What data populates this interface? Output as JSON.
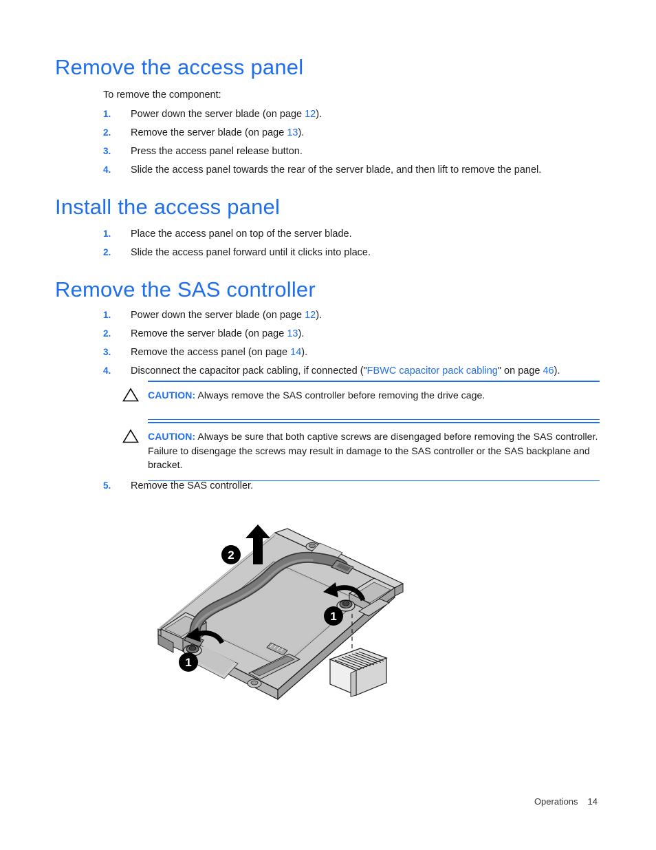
{
  "document": {
    "sections": [
      {
        "id": "remove-access-panel",
        "heading": "Remove the access panel",
        "intro": "To remove the component:",
        "steps": [
          {
            "num": "1.",
            "pre": "Power down the server blade (on page ",
            "link": "12",
            "post": ")."
          },
          {
            "num": "2.",
            "pre": "Remove the server blade (on page ",
            "link": "13",
            "post": ")."
          },
          {
            "num": "3.",
            "pre": "Press the access panel release button.",
            "link": "",
            "post": ""
          },
          {
            "num": "4.",
            "pre": "Slide the access panel towards the rear of the server blade, and then lift to remove the panel.",
            "link": "",
            "post": ""
          }
        ]
      },
      {
        "id": "install-access-panel",
        "heading": "Install the access panel",
        "steps": [
          {
            "num": "1.",
            "pre": "Place the access panel on top of the server blade.",
            "link": "",
            "post": ""
          },
          {
            "num": "2.",
            "pre": "Slide the access panel forward until it clicks into place.",
            "link": "",
            "post": ""
          }
        ]
      },
      {
        "id": "remove-sas-controller",
        "heading": "Remove the SAS controller",
        "steps": [
          {
            "num": "1.",
            "pre": "Power down the server blade (on page ",
            "link": "12",
            "post": ")."
          },
          {
            "num": "2.",
            "pre": "Remove the server blade (on page ",
            "link": "13",
            "post": ")."
          },
          {
            "num": "3.",
            "pre": "Remove the access panel (on page ",
            "link": "14",
            "post": ")."
          },
          {
            "num": "4.",
            "pre": "Disconnect the capacitor pack cabling, if connected (\"",
            "link": "FBWC capacitor pack cabling",
            "post": "\" on page ",
            "link2": "46",
            "post2": ")."
          }
        ],
        "final_step": {
          "num": "5.",
          "pre": "Remove the SAS controller.",
          "link": "",
          "post": ""
        }
      }
    ],
    "cautions": [
      {
        "icon": "warning-triangle-icon",
        "label": "CAUTION:",
        "text": "Always remove the SAS controller before removing the drive cage."
      },
      {
        "icon": "warning-triangle-icon",
        "label": "CAUTION:",
        "text": "Always be sure that both captive screws are disengaged before removing the SAS controller. Failure to disengage the screws may result in damage to the SAS controller or the SAS backplane and bracket."
      }
    ],
    "figure": {
      "name": "sas-controller-removal-diagram",
      "callouts": [
        {
          "id": "callout-1-left",
          "label": "1"
        },
        {
          "id": "callout-1-right",
          "label": "1"
        },
        {
          "id": "callout-2-lift",
          "label": "2"
        }
      ],
      "colors": {
        "board_fill": "#c9c9c9",
        "board_edge": "#1a1a1a",
        "cable": "#6f6f6f",
        "cable_dark": "#4b4b4b",
        "connector_fill": "#e8e8e8",
        "callout_bg": "#000000",
        "callout_text": "#ffffff"
      }
    },
    "footer": {
      "section": "Operations",
      "page": "14"
    },
    "theme": {
      "heading_color": "#1f6fec",
      "link_color": "#1f6fec",
      "caution_rule_color": "#1f6fec",
      "body_color": "#1a1a1a"
    }
  }
}
